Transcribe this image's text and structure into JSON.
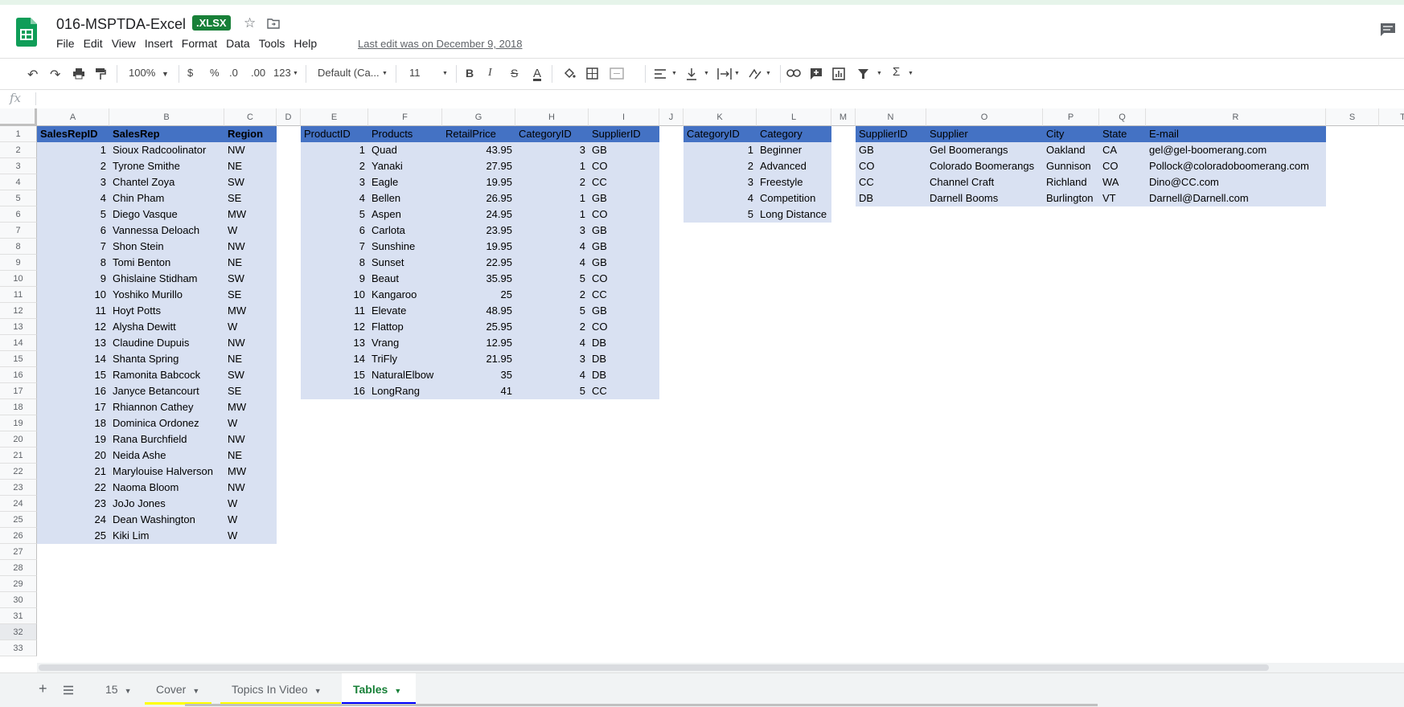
{
  "document": {
    "title": "016-MSPTDA-Excel",
    "badge": ".XLSX",
    "last_edit": "Last edit was on December 9, 2018"
  },
  "menu": [
    "File",
    "Edit",
    "View",
    "Insert",
    "Format",
    "Data",
    "Tools",
    "Help"
  ],
  "toolbar": {
    "zoom": "100%",
    "currency": "$",
    "percent": "%",
    "decrease_decimals": ".0",
    "increase_decimals": ".00",
    "more_formats": "123",
    "font": "Default (Ca...",
    "font_size": "11",
    "bold": "B",
    "italic": "I",
    "strikethrough": "S",
    "text_color": "A"
  },
  "formula_bar": {
    "fx_label": "fx",
    "value": ""
  },
  "columns": [
    "A",
    "B",
    "C",
    "D",
    "E",
    "F",
    "G",
    "H",
    "I",
    "J",
    "K",
    "L",
    "M",
    "N",
    "O",
    "P",
    "Q",
    "R",
    "S",
    "T"
  ],
  "rows": [
    "1",
    "2",
    "3",
    "4",
    "5",
    "6",
    "7",
    "8",
    "9",
    "10",
    "11",
    "12",
    "13",
    "14",
    "15",
    "16",
    "17",
    "18",
    "19",
    "20",
    "21",
    "22",
    "23",
    "24",
    "25",
    "26",
    "27",
    "28",
    "29",
    "30",
    "31",
    "32",
    "33"
  ],
  "colors": {
    "header_fill": "#4472c4",
    "band_fill": "#d9e1f2",
    "active_tab": "#188038",
    "cover_tab_line": "#ffff00",
    "topics_tab_line": "#ffff00",
    "tables_tab_line": "#0000ff"
  },
  "tables": {
    "sales_reps": {
      "headers": [
        "SalesRepID",
        "SalesRep",
        "Region"
      ],
      "rows": [
        [
          "1",
          "Sioux Radcoolinator",
          "NW"
        ],
        [
          "2",
          "Tyrone Smithe",
          "NE"
        ],
        [
          "3",
          "Chantel Zoya",
          "SW"
        ],
        [
          "4",
          "Chin Pham",
          "SE"
        ],
        [
          "5",
          "Diego Vasque",
          "MW"
        ],
        [
          "6",
          "Vannessa Deloach",
          "W"
        ],
        [
          "7",
          "Shon Stein",
          "NW"
        ],
        [
          "8",
          "Tomi Benton",
          "NE"
        ],
        [
          "9",
          "Ghislaine Stidham",
          "SW"
        ],
        [
          "10",
          "Yoshiko Murillo",
          "SE"
        ],
        [
          "11",
          "Hoyt Potts",
          "MW"
        ],
        [
          "12",
          "Alysha Dewitt",
          "W"
        ],
        [
          "13",
          "Claudine Dupuis",
          "NW"
        ],
        [
          "14",
          "Shanta Spring",
          "NE"
        ],
        [
          "15",
          "Ramonita Babcock",
          "SW"
        ],
        [
          "16",
          "Janyce Betancourt",
          "SE"
        ],
        [
          "17",
          "Rhiannon Cathey",
          "MW"
        ],
        [
          "18",
          "Dominica Ordonez",
          "W"
        ],
        [
          "19",
          "Rana Burchfield",
          "NW"
        ],
        [
          "20",
          "Neida Ashe",
          "NE"
        ],
        [
          "21",
          "Marylouise Halverson",
          "MW"
        ],
        [
          "22",
          "Naoma Bloom",
          "NW"
        ],
        [
          "23",
          "JoJo Jones",
          "W"
        ],
        [
          "24",
          "Dean Washington",
          "W"
        ],
        [
          "25",
          "Kiki Lim",
          "W"
        ]
      ]
    },
    "products": {
      "headers": [
        "ProductID",
        "Products",
        "RetailPrice",
        "CategoryID",
        "SupplierID"
      ],
      "rows": [
        [
          "1",
          "Quad",
          "43.95",
          "3",
          "GB"
        ],
        [
          "2",
          "Yanaki",
          "27.95",
          "1",
          "CO"
        ],
        [
          "3",
          "Eagle",
          "19.95",
          "2",
          "CC"
        ],
        [
          "4",
          "Bellen",
          "26.95",
          "1",
          "GB"
        ],
        [
          "5",
          "Aspen",
          "24.95",
          "1",
          "CO"
        ],
        [
          "6",
          "Carlota",
          "23.95",
          "3",
          "GB"
        ],
        [
          "7",
          "Sunshine",
          "19.95",
          "4",
          "GB"
        ],
        [
          "8",
          "Sunset",
          "22.95",
          "4",
          "GB"
        ],
        [
          "9",
          "Beaut",
          "35.95",
          "5",
          "CO"
        ],
        [
          "10",
          "Kangaroo",
          "25",
          "2",
          "CC"
        ],
        [
          "11",
          "Elevate",
          "48.95",
          "5",
          "GB"
        ],
        [
          "12",
          "Flattop",
          "25.95",
          "2",
          "CO"
        ],
        [
          "13",
          "Vrang",
          "12.95",
          "4",
          "DB"
        ],
        [
          "14",
          "TriFly",
          "21.95",
          "3",
          "DB"
        ],
        [
          "15",
          "NaturalElbow",
          "35",
          "4",
          "DB"
        ],
        [
          "16",
          "LongRang",
          "41",
          "5",
          "CC"
        ]
      ]
    },
    "categories": {
      "headers": [
        "CategoryID",
        "Category"
      ],
      "rows": [
        [
          "1",
          "Beginner"
        ],
        [
          "2",
          "Advanced"
        ],
        [
          "3",
          "Freestyle"
        ],
        [
          "4",
          "Competition"
        ],
        [
          "5",
          "Long Distance"
        ]
      ]
    },
    "suppliers": {
      "headers": [
        "SupplierID",
        "Supplier",
        "City",
        "State",
        "E-mail"
      ],
      "rows": [
        [
          "GB",
          "Gel Boomerangs",
          "Oakland",
          "CA",
          "gel@gel-boomerang.com"
        ],
        [
          "CO",
          "Colorado Boomerangs",
          "Gunnison",
          "CO",
          "Pollock@coloradoboomerang.com"
        ],
        [
          "CC",
          "Channel Craft",
          "Richland",
          "WA",
          "Dino@CC.com"
        ],
        [
          "DB",
          "Darnell Booms",
          "Burlington",
          "VT",
          "Darnell@Darnell.com"
        ]
      ]
    }
  },
  "sheet_tabs": [
    {
      "label": "15",
      "active": false
    },
    {
      "label": "Cover",
      "active": false
    },
    {
      "label": "Topics In Video",
      "active": false
    },
    {
      "label": "Tables",
      "active": true
    }
  ],
  "icons": {
    "logo": "sheets-logo-icon",
    "star": "star-icon",
    "move": "folder-move-icon",
    "comments": "comment-icon"
  }
}
